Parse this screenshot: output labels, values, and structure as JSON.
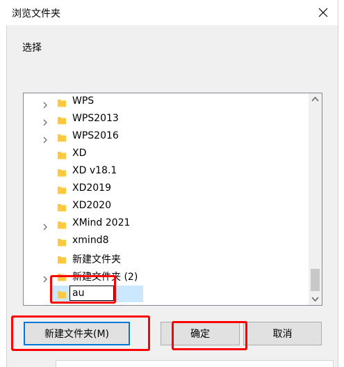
{
  "window": {
    "title": "浏览文件夹",
    "prompt": "选择"
  },
  "tree": {
    "items": [
      {
        "label": "WPS",
        "expandable": true
      },
      {
        "label": "WPS2013",
        "expandable": true
      },
      {
        "label": "WPS2016",
        "expandable": true
      },
      {
        "label": "XD",
        "expandable": false
      },
      {
        "label": "XD v18.1",
        "expandable": false
      },
      {
        "label": "XD2019",
        "expandable": false
      },
      {
        "label": "XD2020",
        "expandable": false
      },
      {
        "label": "XMind 2021",
        "expandable": true
      },
      {
        "label": "xmind8",
        "expandable": false
      },
      {
        "label": "新建文件夹",
        "expandable": false
      },
      {
        "label": "新建文件夹 (2)",
        "expandable": true
      }
    ],
    "editing": {
      "value": "au"
    }
  },
  "buttons": {
    "new_folder": "新建文件夹(M)",
    "ok": "确定",
    "cancel": "取消"
  },
  "colors": {
    "folder": "#ffc83d",
    "selection": "#cce8ff",
    "focus_border": "#0078d7",
    "annotation": "#ff0000"
  },
  "icons": {
    "close": "close-icon",
    "expand": "chevron-right-icon",
    "folder": "folder-icon",
    "scroll_up": "arrow-up-icon",
    "scroll_down": "arrow-down-icon"
  }
}
